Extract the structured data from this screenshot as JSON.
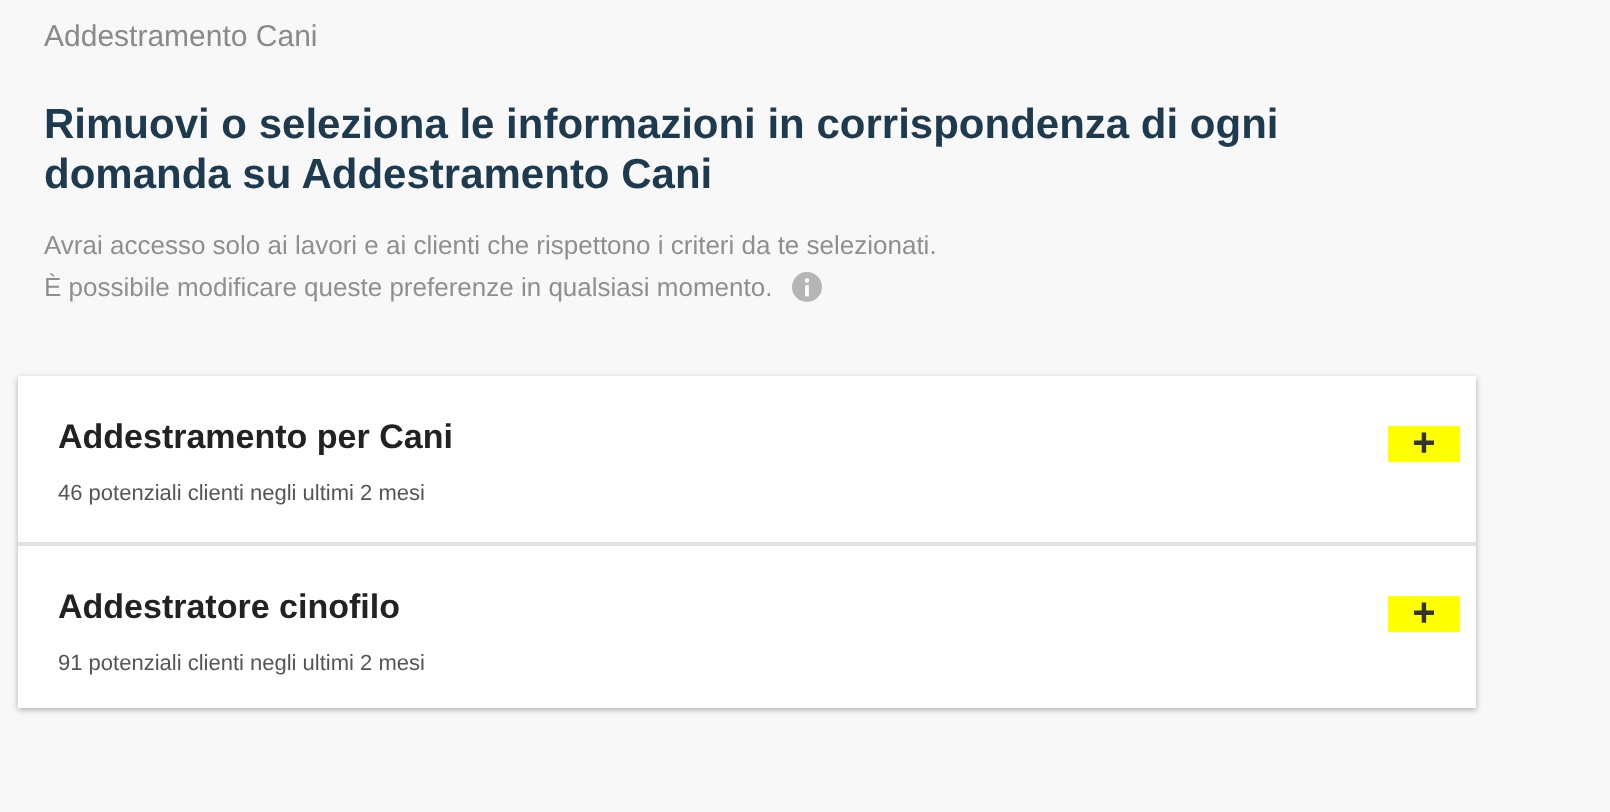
{
  "breadcrumb": "Addestramento Cani",
  "heading": "Rimuovi o seleziona le informazioni in corrispondenza di ogni domanda su Addestramento Cani",
  "description": [
    "Avrai accesso solo ai lavori e ai clienti che rispettono i criteri da te selezionati.",
    "È possibile modificare queste preferenze in qualsiasi momento."
  ],
  "services": [
    {
      "title": "Addestramento per Cani",
      "subtitle": "46 potenziali clienti negli ultimi 2 mesi",
      "button": "+"
    },
    {
      "title": "Addestratore cinofilo",
      "subtitle": "91 potenziali clienti negli ultimi 2 mesi",
      "button": "+"
    }
  ]
}
